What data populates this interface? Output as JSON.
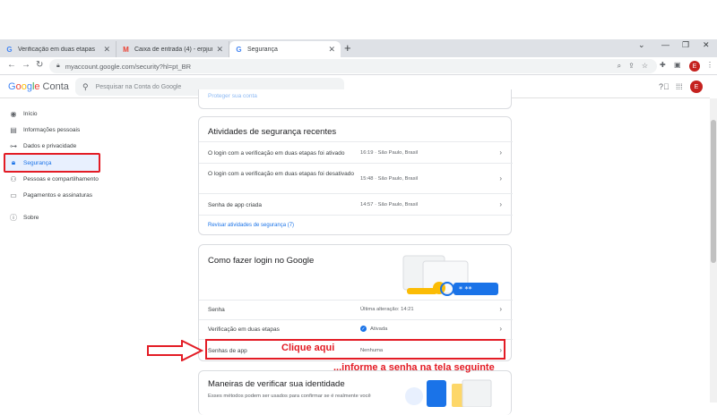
{
  "browser": {
    "tabs": [
      {
        "label": "Verificação em duas etapas",
        "favicon": "G"
      },
      {
        "label": "Caixa de entrada (4) - erpjunho2...",
        "favicon": "M"
      },
      {
        "label": "Segurança",
        "favicon": "G"
      }
    ],
    "new_tab": "+",
    "url": "myaccount.google.com/security?hl=pt_BR",
    "avatar_letter": "E"
  },
  "header": {
    "logo_google": [
      "G",
      "o",
      "o",
      "g",
      "l",
      "e"
    ],
    "logo_conta": "Conta",
    "search_placeholder": "Pesquisar na Conta do Google",
    "avatar_letter": "E"
  },
  "sidebar": {
    "items": [
      {
        "label": "Início",
        "icon": "user-circle-icon"
      },
      {
        "label": "Informações pessoais",
        "icon": "id-card-icon"
      },
      {
        "label": "Dados e privacidade",
        "icon": "toggle-icon"
      },
      {
        "label": "Segurança",
        "icon": "lock-icon",
        "active": true
      },
      {
        "label": "Pessoas e compartilhamento",
        "icon": "people-icon"
      },
      {
        "label": "Pagamentos e assinaturas",
        "icon": "card-icon"
      },
      {
        "label": "Sobre",
        "icon": "info-icon"
      }
    ]
  },
  "top_card": {
    "faded_link": "Proteger sua conta"
  },
  "activity": {
    "title": "Atividades de segurança recentes",
    "rows": [
      {
        "label": "O login com a verificação em duas etapas foi ativado",
        "value": "16:19 · São Paulo, Brasil"
      },
      {
        "label": "O login com a verificação em duas etapas foi desativado",
        "value": "15:48 · São Paulo, Brasil"
      },
      {
        "label": "Senha de app criada",
        "value": "14:57 · São Paulo, Brasil"
      }
    ],
    "review_link": "Revisar atividades de segurança (7)"
  },
  "signin": {
    "title": "Como fazer login no Google",
    "rows": [
      {
        "label": "Senha",
        "value": "Última alteração: 14:21"
      },
      {
        "label": "Verificação em duas etapas",
        "value": "Ativada"
      },
      {
        "label": "Senhas de app",
        "value": "Nenhuma"
      }
    ]
  },
  "verify": {
    "title": "Maneiras de verificar sua identidade",
    "desc": "Esses métodos podem ser usados para confirmar se é realmente você"
  },
  "annotations": {
    "click_here": "Clique aqui",
    "inform": "...informe a senha na tela seguinte"
  },
  "colors": {
    "accent": "#1a73e8",
    "annotation_red": "#e31c25",
    "avatar": "#c5221f"
  }
}
